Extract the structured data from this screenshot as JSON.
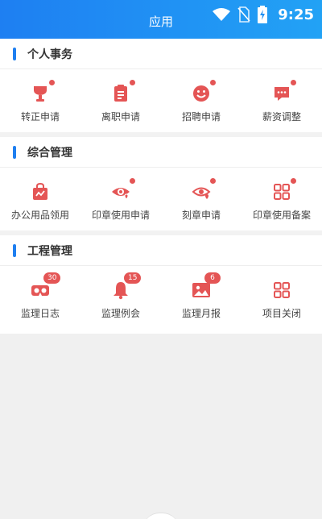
{
  "header": {
    "title": "应用",
    "time": "9:25"
  },
  "sections": [
    {
      "title": "个人事务",
      "items": [
        {
          "label": "转正申请",
          "icon": "trophy-icon"
        },
        {
          "label": "离职申请",
          "icon": "clipboard-icon"
        },
        {
          "label": "招聘申请",
          "icon": "smiley-icon"
        },
        {
          "label": "薪资调整",
          "icon": "message-icon"
        }
      ]
    },
    {
      "title": "综合管理",
      "items": [
        {
          "label": "办公用品领用",
          "icon": "shopping-bag-icon"
        },
        {
          "label": "印章使用申请",
          "icon": "eye-heart-icon"
        },
        {
          "label": "刻章申请",
          "icon": "eye-heart-outline-icon"
        },
        {
          "label": "印章使用备案",
          "icon": "grid-apps-icon"
        }
      ]
    },
    {
      "title": "工程管理",
      "items": [
        {
          "label": "监理日志",
          "icon": "vr-goggles-icon",
          "badge": "30"
        },
        {
          "label": "监理例会",
          "icon": "bell-icon",
          "badge": "15"
        },
        {
          "label": "监理月报",
          "icon": "image-icon",
          "badge": "6"
        },
        {
          "label": "项目关闭",
          "icon": "grid-apps-icon"
        }
      ]
    }
  ],
  "colors": {
    "header_start": "#1e7ff2",
    "header_end": "#22a2f5",
    "accent": "#1f7ff0",
    "icon_red": "#e45555"
  }
}
